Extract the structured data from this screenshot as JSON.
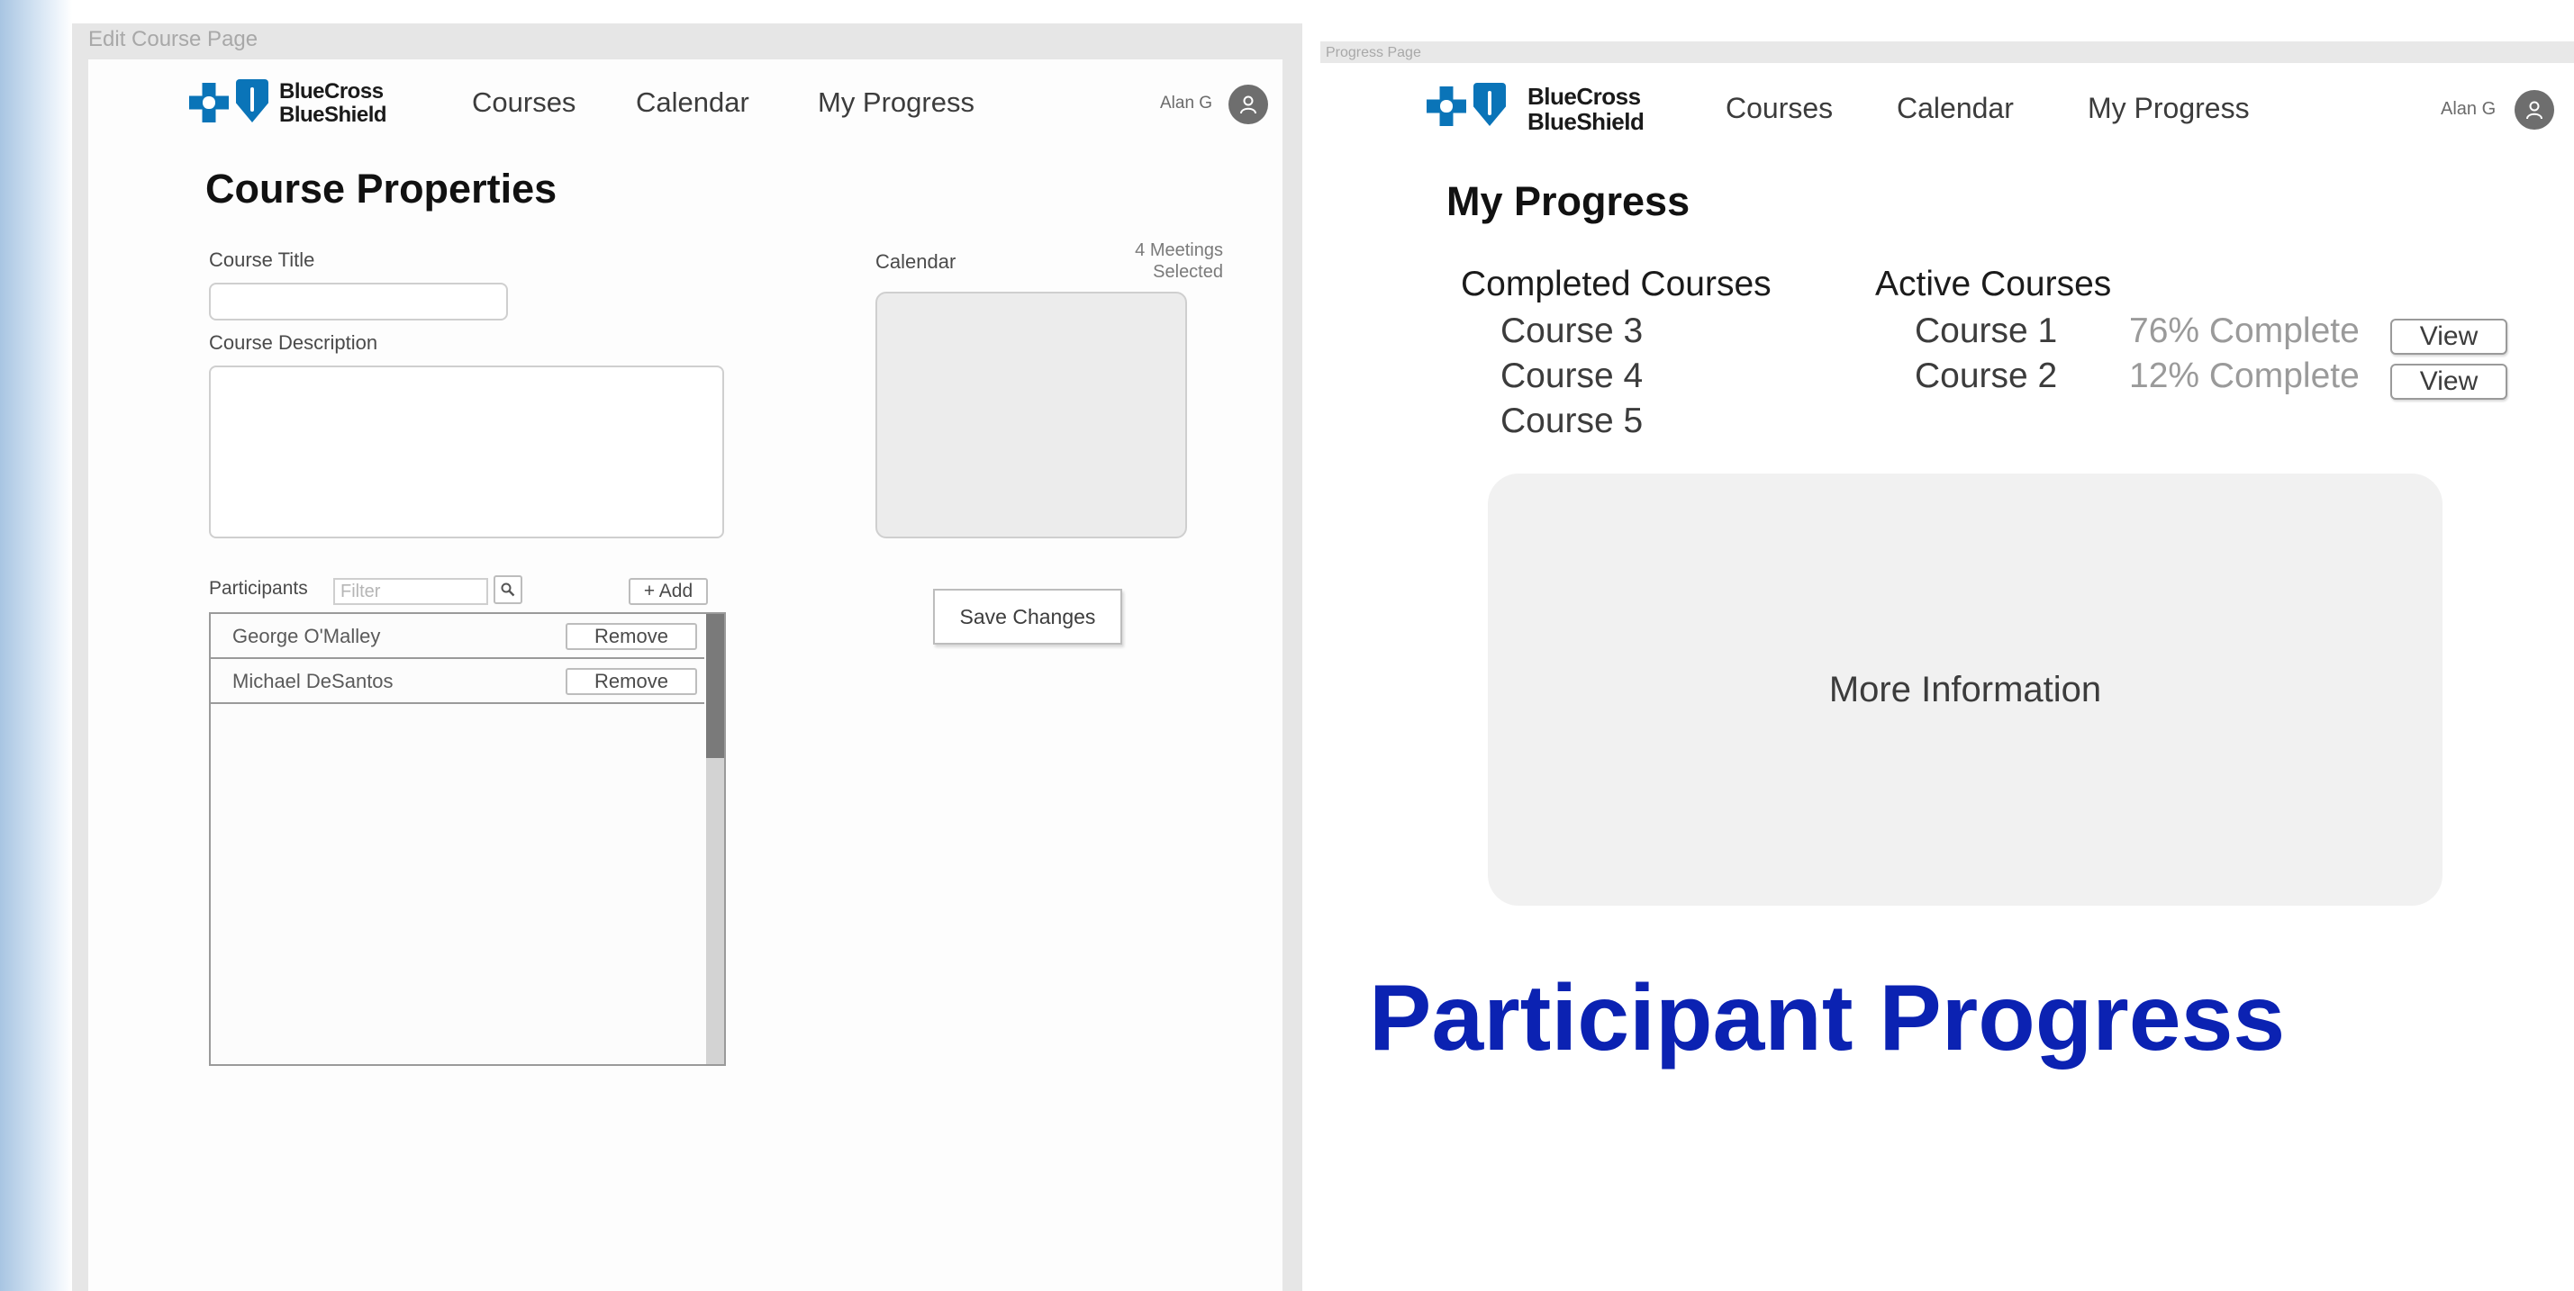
{
  "left_frame": {
    "label": "Edit Course Page",
    "nav": {
      "logo_line1": "BlueCross",
      "logo_line2": "BlueShield",
      "links": [
        "Courses",
        "Calendar",
        "My Progress"
      ],
      "user": "Alan G"
    },
    "heading": "Course Properties",
    "course_title_label": "Course Title",
    "course_description_label": "Course Description",
    "calendar_label": "Calendar",
    "meetings_line1": "4 Meetings",
    "meetings_line2": "Selected",
    "participants_label": "Participants",
    "filter_placeholder": "Filter",
    "add_label": "+ Add",
    "participants": [
      {
        "name": "George O'Malley",
        "action": "Remove"
      },
      {
        "name": "Michael DeSantos",
        "action": "Remove"
      }
    ],
    "save_label": "Save Changes"
  },
  "right_frame": {
    "label": "Progress Page",
    "nav": {
      "logo_line1": "BlueCross",
      "logo_line2": "BlueShield",
      "links": [
        "Courses",
        "Calendar",
        "My Progress"
      ],
      "user": "Alan G"
    },
    "heading": "My Progress",
    "completed_heading": "Completed Courses",
    "completed": [
      "Course 3",
      "Course 4",
      "Course 5"
    ],
    "active_heading": "Active Courses",
    "active": [
      {
        "name": "Course 1",
        "progress": "76% Complete",
        "action": "View"
      },
      {
        "name": "Course 2",
        "progress": "12% Complete",
        "action": "View"
      }
    ],
    "more_info": "More Information"
  },
  "caption": "Participant Progress",
  "colors": {
    "brand_blue": "#0a74b8",
    "caption_blue": "#0b22b2",
    "frame_gray": "#e6e6e6"
  },
  "icons": [
    "search-icon",
    "user-icon",
    "bluecross-logo-icon",
    "blueshield-logo-icon"
  ]
}
